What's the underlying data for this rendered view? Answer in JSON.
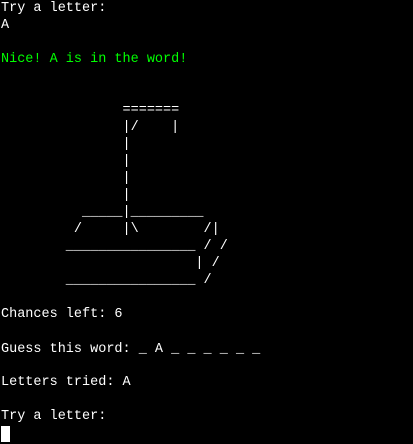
{
  "terminal": {
    "prompt1": "Try a letter:",
    "input1": "A",
    "message": "Nice! A is in the word!",
    "message_color": "#00ff00",
    "hangman_art": "               =======\n               |/    |\n               |\n               |\n               |\n               |\n          _____|_________\n         /     |\\        /|\n        ________________ / /\n                        | /\n        ________________ /",
    "chances_line": "Chances left: 6",
    "guess_line": "Guess this word: _ A _ _ _ _ _ _",
    "tried_line": "Letters tried: A",
    "prompt2": "Try a letter:"
  }
}
